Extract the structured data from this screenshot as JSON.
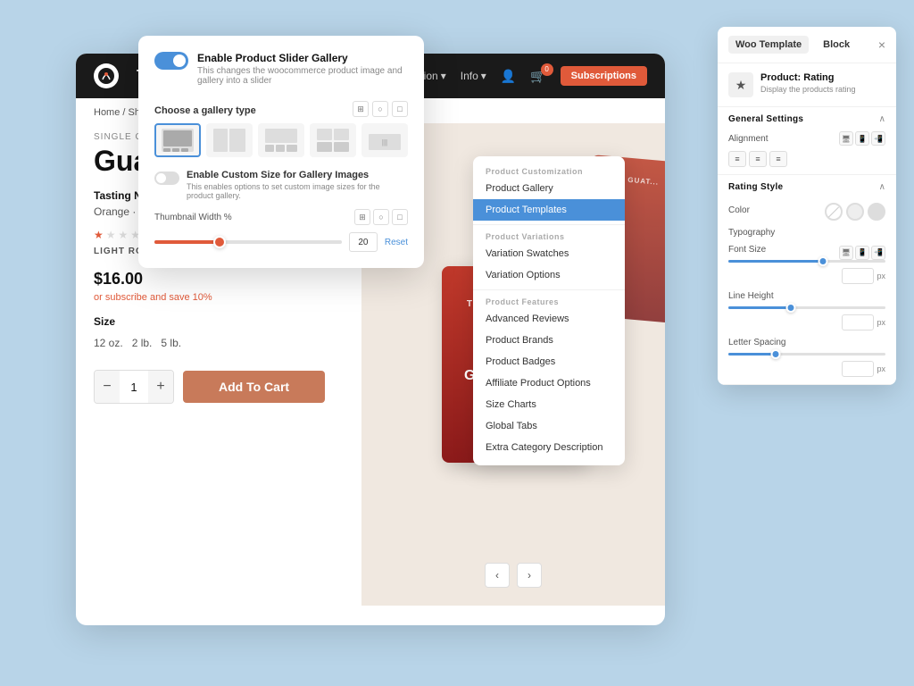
{
  "colors": {
    "bg": "#b8d4e8",
    "dark": "#1a1a1a",
    "accent": "#e05a3a",
    "blue": "#4a90d9",
    "light_bg": "#f0e8e0",
    "white": "#ffffff"
  },
  "header": {
    "logo": "TOUCAN",
    "nav_links": [
      "Location",
      "Info"
    ],
    "cart_count": "0",
    "subscriptions_btn": "Subscriptions"
  },
  "breadcrumb": {
    "text": "Home / Shop / Coffee"
  },
  "product": {
    "label": "SINGLE ORIGIN",
    "title": "Guatemala",
    "tasting_notes_label": "Tasting Notes:",
    "tasting_notes": "Orange · Fruity · Licorice",
    "roast_label": "LIGHT ROAST",
    "price": "$16.00",
    "subscribe_text": "or subscribe and save 10%",
    "size_label": "Size",
    "sizes": [
      "12 oz.",
      "2 lb.",
      "5 lb."
    ],
    "qty": "1",
    "add_to_cart": "Add To Cart"
  },
  "plugin_panel": {
    "slider_toggle_label": "Enable Product Slider Gallery",
    "slider_toggle_desc": "This changes the woocommerce product image and gallery into a slider",
    "gallery_section_label": "Choose a gallery type",
    "custom_size_label": "Enable Custom Size for Gallery Images",
    "custom_size_desc": "This enables options to set custom image sizes for the product gallery.",
    "thumbnail_label": "Thumbnail Width %",
    "thumbnail_value": "20",
    "reset_btn": "Reset"
  },
  "context_menu": {
    "customization_label": "Product Customization",
    "items": [
      {
        "label": "Product Gallery",
        "active": false
      },
      {
        "label": "Product Templates",
        "active": true
      }
    ],
    "variations_label": "Product Variations",
    "variation_items": [
      {
        "label": "Variation Swatches"
      },
      {
        "label": "Variation Options"
      }
    ],
    "features_label": "Product Features",
    "feature_items": [
      {
        "label": "Advanced Reviews"
      },
      {
        "label": "Product Brands"
      },
      {
        "label": "Product Badges"
      },
      {
        "label": "Affiliate Product Options"
      },
      {
        "label": "Size Charts"
      },
      {
        "label": "Global Tabs"
      },
      {
        "label": "Extra Category Description"
      }
    ]
  },
  "woo_panel": {
    "tabs": [
      "Woo Template",
      "Block"
    ],
    "close_btn": "×",
    "block_title": "Product: Rating",
    "block_desc": "Display the products rating",
    "sections": {
      "general": {
        "title": "General Settings",
        "alignment_label": "Alignment"
      },
      "rating_style": {
        "title": "Rating Style",
        "color_label": "Color",
        "typography_label": "Typography",
        "font_size_label": "Font Size",
        "line_height_label": "Line Height",
        "letter_spacing_label": "Letter Spacing"
      }
    },
    "unit": "px"
  }
}
